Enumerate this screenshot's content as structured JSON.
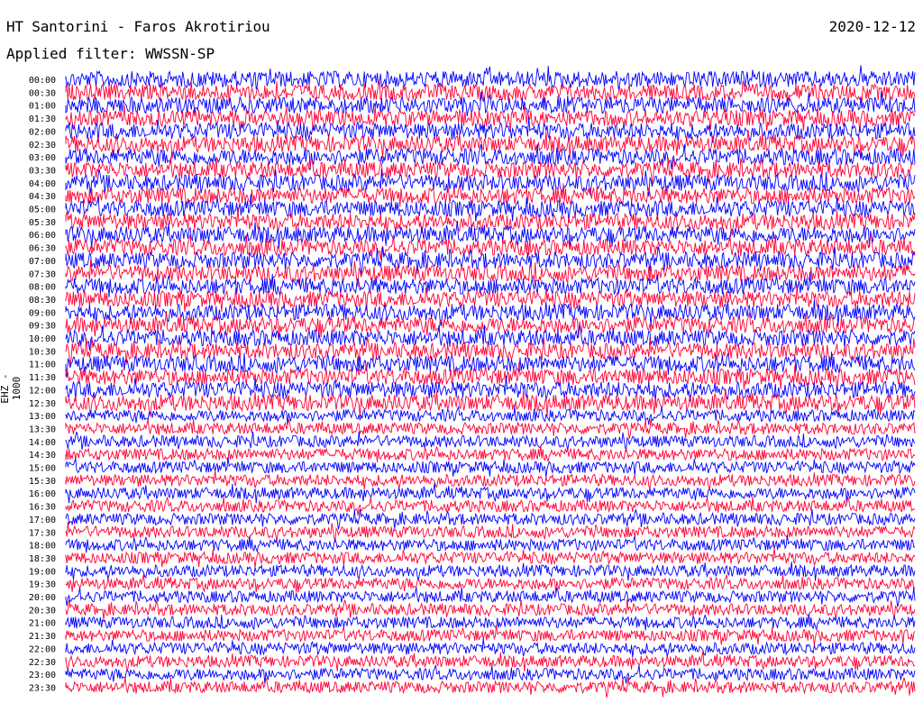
{
  "header": {
    "station": "HT Santorini - Faros Akrotiriou",
    "date": "2020-12-12",
    "filter": "Applied filter: WWSSN-SP",
    "channel": "EHZ - 1000"
  },
  "colors": {
    "trace_a": "#0000ff",
    "trace_b": "#ff0033",
    "background": "#ffffff",
    "text": "#000000"
  },
  "chart_data": {
    "type": "line",
    "title": "HT Santorini - Faros Akrotiriou",
    "ylabel": "EHZ - 1000",
    "grid": false,
    "legend": "none",
    "series_alternate_colors": [
      "#0000ff",
      "#ff0033"
    ],
    "row_labels": [
      "00:00",
      "00:30",
      "01:00",
      "01:30",
      "02:00",
      "02:30",
      "03:00",
      "03:30",
      "04:00",
      "04:30",
      "05:00",
      "05:30",
      "06:00",
      "06:30",
      "07:00",
      "07:30",
      "08:00",
      "08:30",
      "09:00",
      "09:30",
      "10:00",
      "10:30",
      "11:00",
      "11:30",
      "12:00",
      "12:30",
      "13:00",
      "13:30",
      "14:00",
      "14:30",
      "15:00",
      "15:30",
      "16:00",
      "16:30",
      "17:00",
      "17:30",
      "18:00",
      "18:30",
      "19:00",
      "19:30",
      "20:00",
      "20:30",
      "21:00",
      "21:30",
      "22:00",
      "22:30",
      "23:00",
      "23:30"
    ]
  }
}
